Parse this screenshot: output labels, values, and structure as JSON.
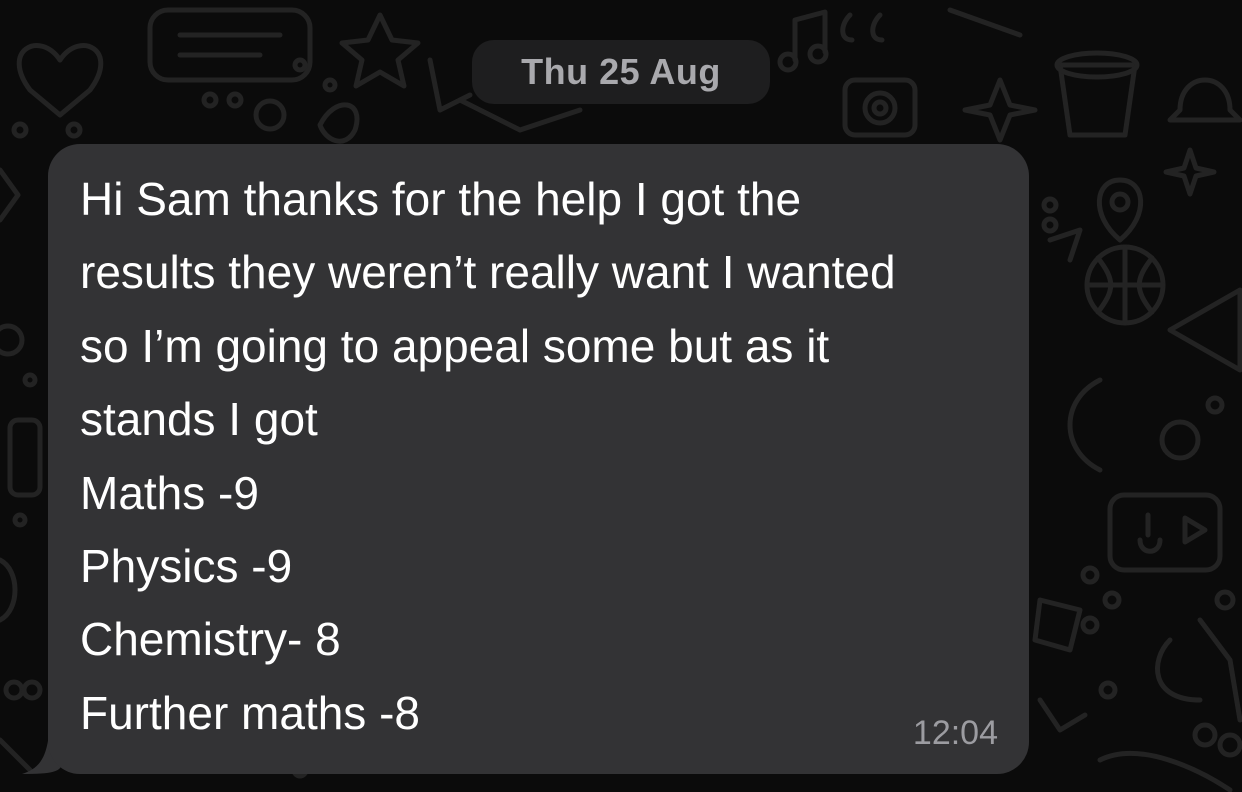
{
  "chat": {
    "date_separator": "Thu 25 Aug",
    "message": {
      "lines": [
        "Hi Sam thanks for the help I got the",
        "results they weren’t really want I wanted",
        "so I’m going to appeal some but as it",
        "stands I got",
        "Maths -9",
        "Physics -9",
        "Chemistry- 8",
        "Further maths -8"
      ],
      "time": "12:04"
    }
  },
  "colors": {
    "background": "#0b0b0b",
    "bubble": "#333335",
    "date_pill": "#1e1e1f",
    "text": "#ffffff",
    "meta_text": "#9c9ca1"
  }
}
